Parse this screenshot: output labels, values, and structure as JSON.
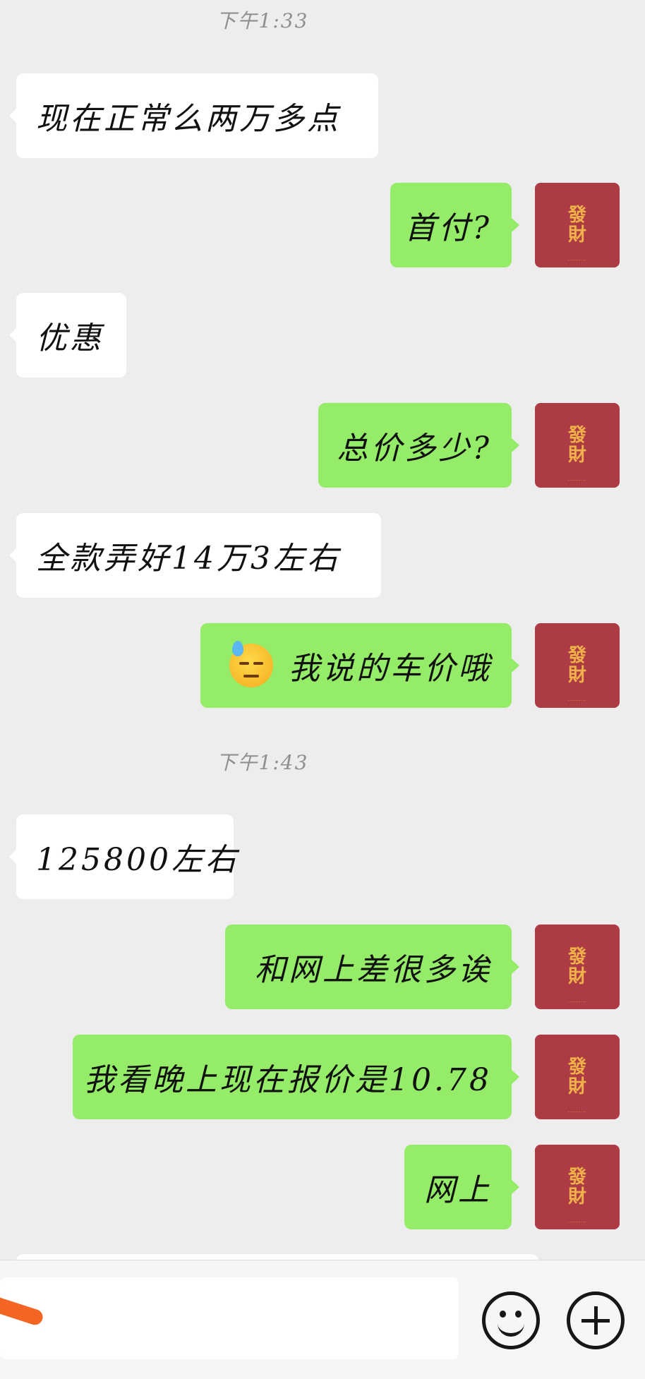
{
  "chat": {
    "times": [
      "下午1:33",
      "下午1:43"
    ],
    "messages": [
      {
        "side": "left",
        "text": "现在正常么两万多点"
      },
      {
        "side": "right",
        "text": "首付?"
      },
      {
        "side": "left",
        "text": "优惠"
      },
      {
        "side": "right",
        "text": "总价多少?"
      },
      {
        "side": "left",
        "text": "全款弄好14万3左右"
      },
      {
        "side": "right",
        "text": "我说的车价哦",
        "emoji": "downcast-face-with-sweat-emoji"
      },
      {
        "side": "left",
        "text": "125800左右"
      },
      {
        "side": "right",
        "text": "和网上差很多诶"
      },
      {
        "side": "right",
        "text": "我看晚上现在报价是10.78"
      },
      {
        "side": "right",
        "text": "网上"
      }
    ]
  },
  "avatar": {
    "glyph_top": "發",
    "glyph_bottom": "財",
    "background": "#ad3b44",
    "glyph_color": "#f0b14a"
  },
  "colors": {
    "background": "#ededed",
    "sent_bubble": "#95ec69",
    "received_bubble": "#ffffff"
  },
  "input_bar": {
    "icons": [
      "emoji-icon",
      "plus-icon"
    ]
  }
}
